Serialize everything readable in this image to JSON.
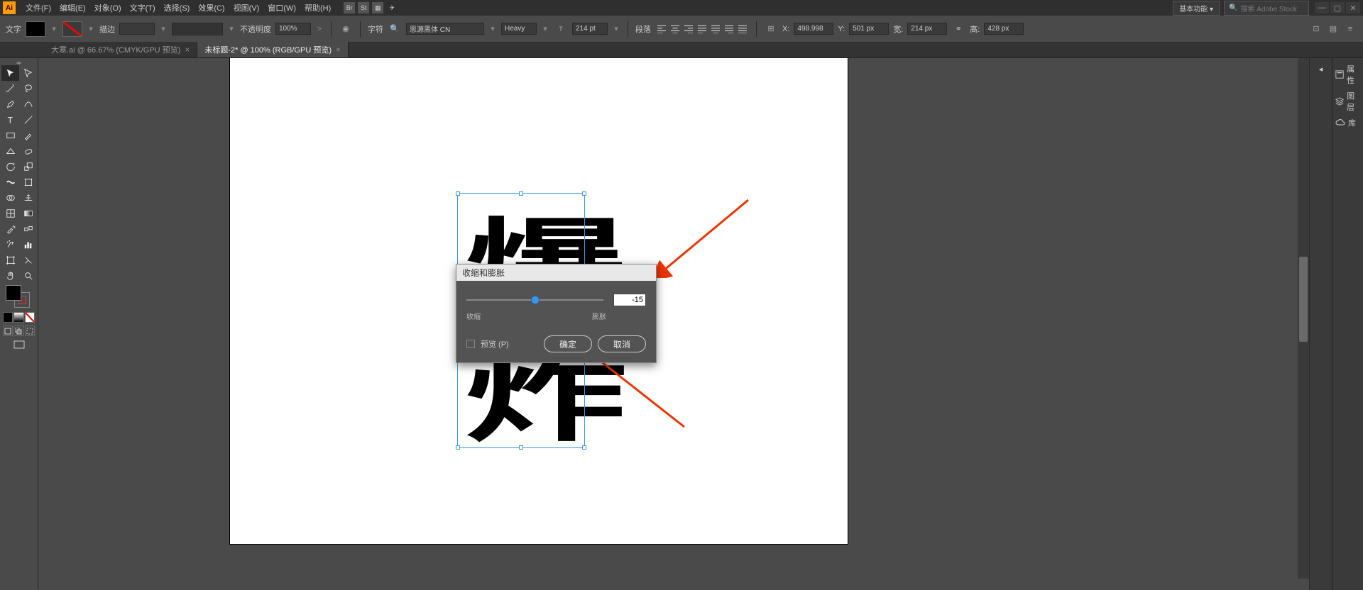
{
  "app": {
    "icon_text": "Ai"
  },
  "menu": [
    "文件(F)",
    "编辑(E)",
    "对象(O)",
    "文字(T)",
    "选择(S)",
    "效果(C)",
    "视图(V)",
    "窗口(W)",
    "帮助(H)"
  ],
  "workspace": "基本功能",
  "search_placeholder": "搜索 Adobe Stock",
  "control": {
    "tool_label": "文字",
    "stroke_label": "描边",
    "stroke_value": "",
    "opacity_label": "不透明度",
    "opacity_value": "100%",
    "char_label": "字符",
    "font_family": "思源黑体 CN",
    "font_style": "Heavy",
    "font_size": "214 pt",
    "para_label": "段落",
    "x_label": "X:",
    "x_value": "498.998",
    "y_label": "Y:",
    "y_value": "501 px",
    "w_label": "宽:",
    "w_value": "214 px",
    "h_label": "高:",
    "h_value": "428 px"
  },
  "tabs": [
    {
      "label": "大寒.ai @ 66.67% (CMYK/GPU 预览)",
      "active": false
    },
    {
      "label": "未标题-2* @ 100% (RGB/GPU 预览)",
      "active": true
    }
  ],
  "canvas": {
    "glyph1": "爆",
    "glyph2": "炸"
  },
  "dialog": {
    "title": "收缩和膨胀",
    "value": "-15",
    "min_label": "收缩",
    "max_label": "膨胀",
    "preview_label": "预览 (P)",
    "ok_label": "确定",
    "cancel_label": "取消",
    "slider_percent": 50
  },
  "right_panels": [
    "属性",
    "图层",
    "库"
  ]
}
